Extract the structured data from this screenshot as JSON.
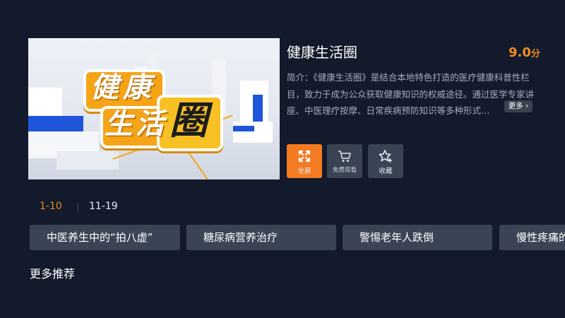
{
  "show": {
    "poster_logo_chars": [
      "健",
      "康",
      "生",
      "活",
      "圈"
    ],
    "title": "健康生活圈",
    "score_value": "9.0",
    "score_unit": "分",
    "description_lines": [
      "简介：《健康生活圈》是结合本地特色打造的医疗健康科普性栏",
      "目，致力于成为公众获取健康知识的权威途径。通过医学专家讲",
      "座、中医理疗按摩、日常疾病预防知识等多种形式…"
    ],
    "more_label": "更多"
  },
  "actions": [
    {
      "label": "全屏",
      "icon": "fullscreen-icon"
    },
    {
      "label": "免费观看",
      "icon": "cart-icon"
    },
    {
      "label": "收藏",
      "icon": "star-plus-icon"
    }
  ],
  "episode_ranges": [
    "1-10",
    "11-19"
  ],
  "episodes": [
    "中医养生中的“拍八虚”",
    "糖尿病营养治疗",
    "警惕老年人跌倒",
    "慢性疼痛的"
  ],
  "section_title": "更多推荐",
  "colors": {
    "accent": "#f47b22",
    "background": "#121a2b",
    "chip": "#3b4454"
  }
}
